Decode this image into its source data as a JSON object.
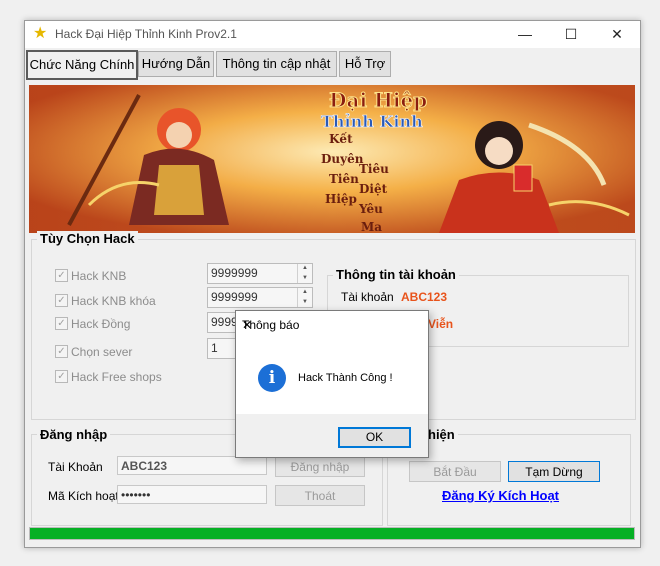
{
  "window": {
    "title": "Hack Đại Hiệp Thỉnh Kinh  Prov2.1",
    "icon": "star-icon",
    "minimize": "—",
    "maximize": "☐",
    "close": "✕"
  },
  "tabs": [
    {
      "label": "Chức Năng Chính"
    },
    {
      "label": "Hướng Dẫn"
    },
    {
      "label": "Thông tin cập nhật"
    },
    {
      "label": "Hỗ Trợ"
    }
  ],
  "banner": {
    "logo_line1": "Đại Hiệp",
    "logo_line2": "Thỉnh Kinh",
    "poem": [
      "Kết",
      "Duyên",
      "Tiên",
      "Hiệp",
      "Tiêu",
      "Diệt",
      "Yêu",
      "Ma"
    ]
  },
  "hack_options": {
    "title": "Tùy Chọn Hack",
    "items": [
      {
        "label": "Hack KNB",
        "value": "9999999",
        "checked": true
      },
      {
        "label": "Hack KNB khóa",
        "value": "9999999",
        "checked": true
      },
      {
        "label": "Hack Đồng",
        "value": "9999",
        "checked": true
      },
      {
        "label": "Chọn sever",
        "value": "1",
        "checked": true
      },
      {
        "label": "Hack Free shops",
        "checked": true
      }
    ]
  },
  "account_info": {
    "title": "Thông tin tài khoản",
    "account_label": "Tài khoản",
    "account_value": "ABC123",
    "second_value": "Viễn"
  },
  "login": {
    "title": "Đăng nhập",
    "username_label": "Tài Khoản",
    "username_value": "ABC123",
    "code_label": "Mã Kích hoạt",
    "code_value": "•••••••",
    "login_button": "Đăng nhập",
    "logout_button": "Thoát"
  },
  "execute": {
    "title": "hiện",
    "start_button": "Bắt Đầu",
    "pause_button": "Tạm Dừng",
    "register_link": "Đăng Ký Kích Hoạt"
  },
  "progress": {
    "value": 1.0
  },
  "dialog": {
    "title": "Thông báo",
    "message": "Hack Thành Công !",
    "ok_button": "OK",
    "icon": "info-icon",
    "close": "✕"
  },
  "colors": {
    "progress_green": "#06b025",
    "accent_orange": "#e8541c",
    "link_blue": "#0000ff",
    "info_blue": "#1c6fd6"
  }
}
